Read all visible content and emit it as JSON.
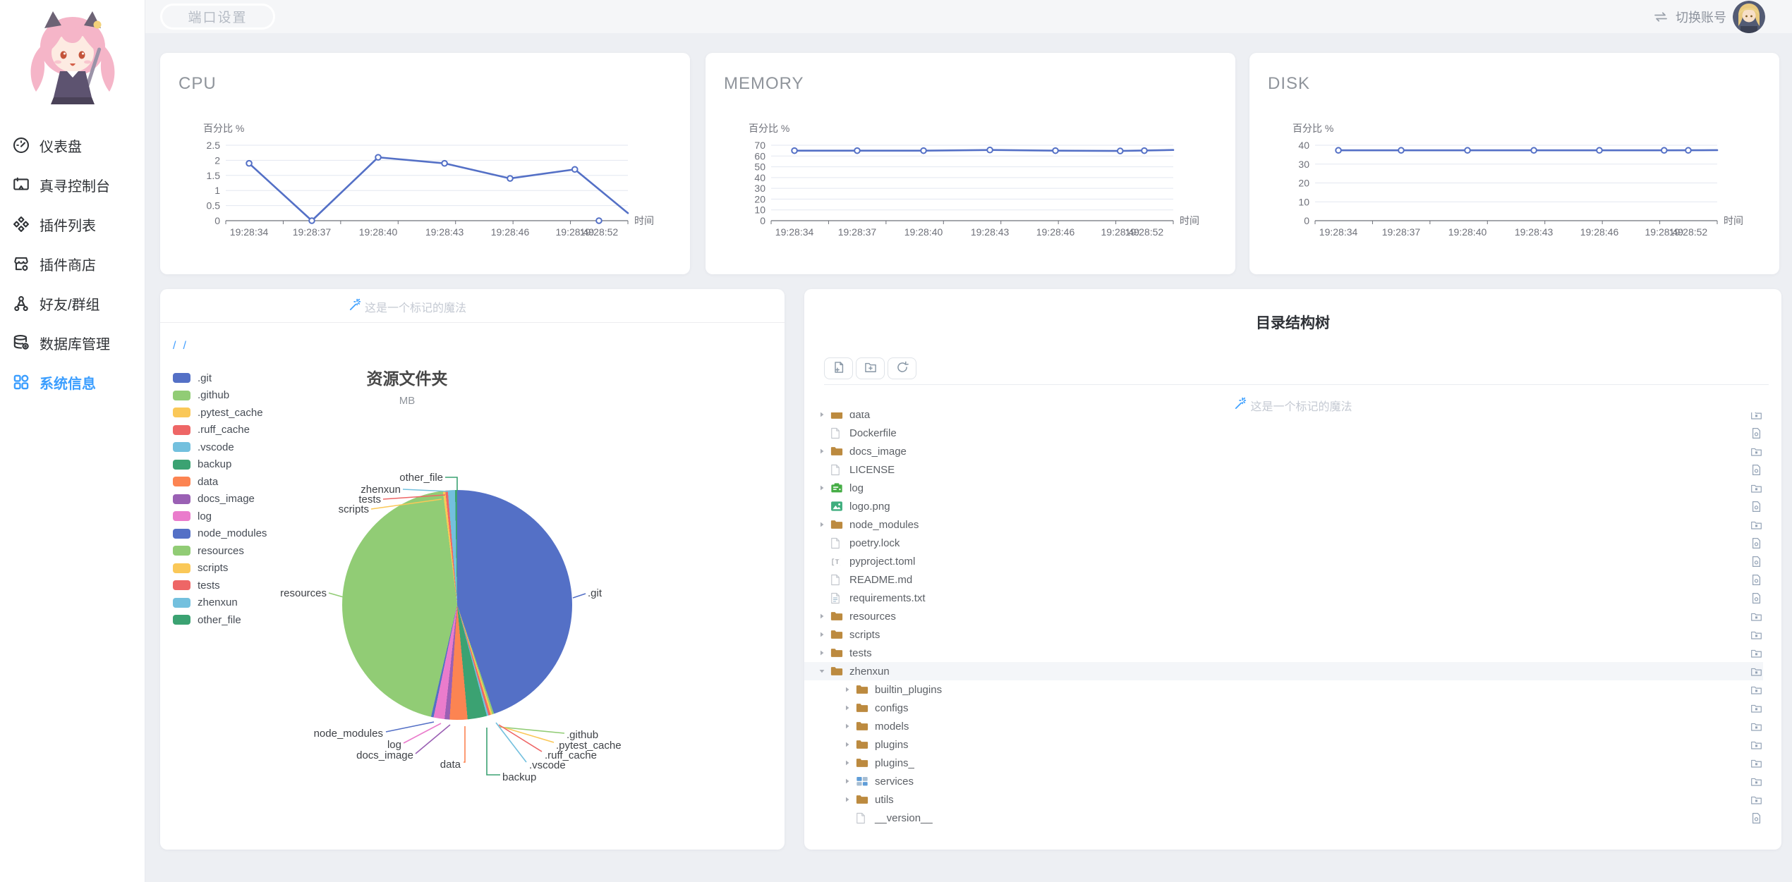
{
  "topbar": {
    "port_button": "端口设置",
    "switch_account": "切换账号"
  },
  "sidebar": {
    "items": [
      {
        "id": "dashboard",
        "label": "仪表盘",
        "icon": "dashboard",
        "active": false
      },
      {
        "id": "console",
        "label": "真寻控制台",
        "icon": "console",
        "active": false
      },
      {
        "id": "plugin-list",
        "label": "插件列表",
        "icon": "plugin-list",
        "active": false
      },
      {
        "id": "plugin-store",
        "label": "插件商店",
        "icon": "plugin-store",
        "active": false
      },
      {
        "id": "friends-groups",
        "label": "好友/群组",
        "icon": "friends",
        "active": false
      },
      {
        "id": "database",
        "label": "数据库管理",
        "icon": "database",
        "active": false
      },
      {
        "id": "system-info",
        "label": "系统信息",
        "icon": "system-info",
        "active": true
      }
    ]
  },
  "chart_data": [
    {
      "id": "cpu",
      "type": "line",
      "title": "CPU",
      "ylabel": "百分比 %",
      "xlabel": "时间",
      "y_ticks": [
        0,
        0.5,
        1,
        1.5,
        2,
        2.5
      ],
      "ylim": [
        0,
        2.5
      ],
      "x": [
        "19:28:34",
        "19:28:37",
        "19:28:40",
        "19:28:43",
        "19:28:46",
        "19:28:49",
        "19:28:52"
      ],
      "values": [
        1.9,
        0,
        2.1,
        1.9,
        1.4,
        1.7,
        0
      ],
      "edge_value": 0.25,
      "line_color": "#5470c6",
      "grid": true,
      "legend_position": "none"
    },
    {
      "id": "memory",
      "type": "line",
      "title": "MEMORY",
      "ylabel": "百分比 %",
      "xlabel": "时间",
      "y_ticks": [
        0,
        10,
        20,
        30,
        40,
        50,
        60,
        70
      ],
      "ylim": [
        0,
        70
      ],
      "x": [
        "19:28:34",
        "19:28:37",
        "19:28:40",
        "19:28:43",
        "19:28:46",
        "19:28:49",
        "19:28:52"
      ],
      "values": [
        65,
        65,
        65,
        65.6,
        65,
        64.7,
        65
      ],
      "edge_value": 65.6,
      "line_color": "#5470c6",
      "grid": true,
      "legend_position": "none"
    },
    {
      "id": "disk",
      "type": "line",
      "title": "DISK",
      "ylabel": "百分比 %",
      "xlabel": "时间",
      "y_ticks": [
        0,
        10,
        20,
        30,
        40
      ],
      "ylim": [
        0,
        40
      ],
      "x": [
        "19:28:34",
        "19:28:37",
        "19:28:40",
        "19:28:43",
        "19:28:46",
        "19:28:49",
        "19:28:52"
      ],
      "values": [
        37.3,
        37.3,
        37.3,
        37.3,
        37.3,
        37.3,
        37.3
      ],
      "edge_value": 37.4,
      "line_color": "#5470c6",
      "grid": true,
      "legend_position": "none"
    },
    {
      "id": "resource-folders",
      "type": "pie",
      "title": "资源文件夹",
      "subtitle": "MB",
      "unit": "MB",
      "note": "values are not labeled in the source image; pct_est are shares estimated from slice angles",
      "slices": [
        {
          "name": ".git",
          "color": "#5470C6",
          "pct_est": 44.8
        },
        {
          "name": ".github",
          "color": "#91CC75",
          "pct_est": 0.25
        },
        {
          "name": ".pytest_cache",
          "color": "#FAC858",
          "pct_est": 0.25
        },
        {
          "name": ".ruff_cache",
          "color": "#EE6666",
          "pct_est": 0.3
        },
        {
          "name": ".vscode",
          "color": "#73C0DE",
          "pct_est": 0.25
        },
        {
          "name": "backup",
          "color": "#3BA272",
          "pct_est": 2.7
        },
        {
          "name": "data",
          "color": "#FC8452",
          "pct_est": 2.5
        },
        {
          "name": "docs_image",
          "color": "#9A60B4",
          "pct_est": 0.7
        },
        {
          "name": "log",
          "color": "#EA7CCC",
          "pct_est": 1.55
        },
        {
          "name": "node_modules",
          "color": "#5470C6",
          "pct_est": 0.35
        },
        {
          "name": "resources",
          "color": "#91CC75",
          "pct_est": 44.35
        },
        {
          "name": "scripts",
          "color": "#FAC858",
          "pct_est": 0.35
        },
        {
          "name": "tests",
          "color": "#EE6666",
          "pct_est": 0.35
        },
        {
          "name": "zhenxun",
          "color": "#73C0DE",
          "pct_est": 1.0
        },
        {
          "name": "other_file",
          "color": "#3BA272",
          "pct_est": 0.3
        }
      ]
    }
  ],
  "pie_card": {
    "magic_note": "这是一个标记的魔法",
    "breadcrumb": [
      "/",
      "/"
    ]
  },
  "tree_card": {
    "title": "目录结构树",
    "magic_note": "这是一个标记的魔法",
    "toolbar": [
      {
        "id": "new-file-button",
        "icon": "new-file"
      },
      {
        "id": "new-folder-button",
        "icon": "new-folder"
      },
      {
        "id": "refresh-button",
        "icon": "refresh"
      }
    ],
    "rows": [
      {
        "name": "data",
        "kind": "folder",
        "level": 1,
        "caret": "collapsed"
      },
      {
        "name": "Dockerfile",
        "kind": "file",
        "level": 1,
        "caret": "none"
      },
      {
        "name": "docs_image",
        "kind": "folder",
        "level": 1,
        "caret": "collapsed"
      },
      {
        "name": "LICENSE",
        "kind": "file",
        "level": 1,
        "caret": "none"
      },
      {
        "name": "log",
        "kind": "folder-log",
        "level": 1,
        "caret": "collapsed"
      },
      {
        "name": "logo.png",
        "kind": "image",
        "level": 1,
        "caret": "none"
      },
      {
        "name": "node_modules",
        "kind": "folder",
        "level": 1,
        "caret": "collapsed"
      },
      {
        "name": "poetry.lock",
        "kind": "file",
        "level": 1,
        "caret": "none"
      },
      {
        "name": "pyproject.toml",
        "kind": "toml",
        "level": 1,
        "caret": "none"
      },
      {
        "name": "README.md",
        "kind": "file",
        "level": 1,
        "caret": "none"
      },
      {
        "name": "requirements.txt",
        "kind": "txt",
        "level": 1,
        "caret": "none"
      },
      {
        "name": "resources",
        "kind": "folder",
        "level": 1,
        "caret": "collapsed"
      },
      {
        "name": "scripts",
        "kind": "folder",
        "level": 1,
        "caret": "collapsed"
      },
      {
        "name": "tests",
        "kind": "folder",
        "level": 1,
        "caret": "collapsed"
      },
      {
        "name": "zhenxun",
        "kind": "folder",
        "level": 1,
        "caret": "expanded",
        "selected": true
      },
      {
        "name": "builtin_plugins",
        "kind": "folder",
        "level": 2,
        "caret": "collapsed"
      },
      {
        "name": "configs",
        "kind": "folder",
        "level": 2,
        "caret": "collapsed"
      },
      {
        "name": "models",
        "kind": "folder",
        "level": 2,
        "caret": "collapsed"
      },
      {
        "name": "plugins",
        "kind": "folder",
        "level": 2,
        "caret": "collapsed"
      },
      {
        "name": "plugins_",
        "kind": "folder",
        "level": 2,
        "caret": "collapsed"
      },
      {
        "name": "services",
        "kind": "services",
        "level": 2,
        "caret": "collapsed"
      },
      {
        "name": "utils",
        "kind": "folder",
        "level": 2,
        "caret": "collapsed"
      },
      {
        "name": "__version__",
        "kind": "file",
        "level": 2,
        "caret": "none"
      }
    ]
  }
}
